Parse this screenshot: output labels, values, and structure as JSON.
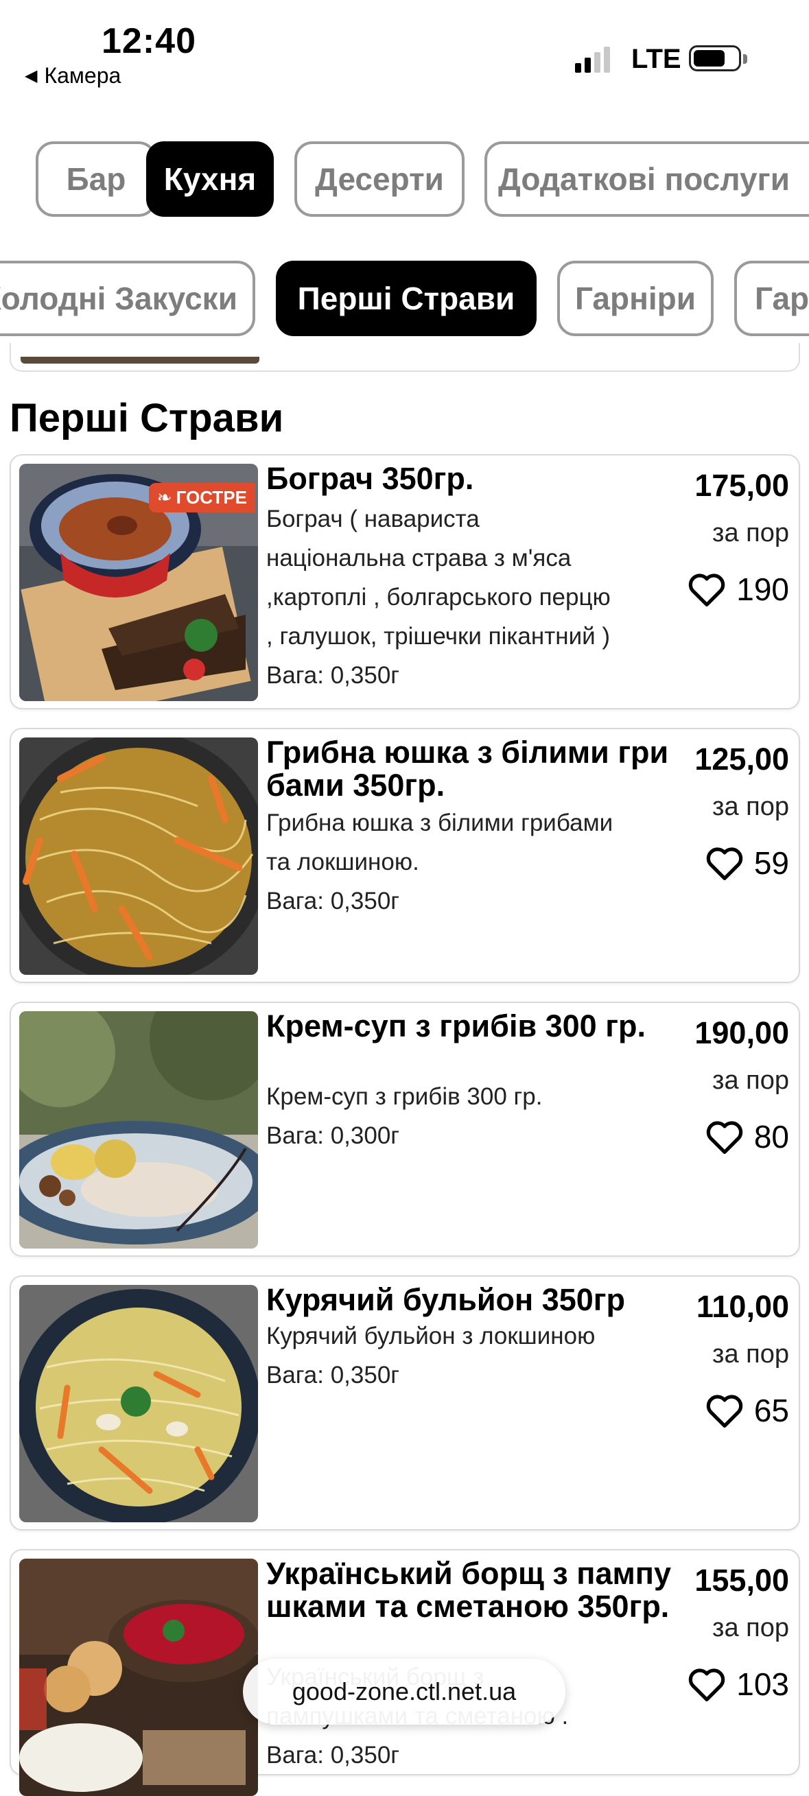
{
  "status_bar": {
    "time": "12:40",
    "back_label": "Камера",
    "network": "LTE",
    "signal_bars": 2
  },
  "category_tabs": [
    {
      "label": "Бар",
      "active": false
    },
    {
      "label": "Кухня",
      "active": true
    },
    {
      "label": "Десерти",
      "active": false
    },
    {
      "label": "Додаткові послуги",
      "active": false
    }
  ],
  "subcategory_tabs": [
    {
      "label": "Холодні Закуски",
      "active": false
    },
    {
      "label": "Перші Страви",
      "active": true
    },
    {
      "label": "Гарніри",
      "active": false
    },
    {
      "label": "Гар",
      "active": false
    }
  ],
  "section": {
    "title": "Перші Страви"
  },
  "unit_label": "за пор",
  "dishes": [
    {
      "title": "Бограч 350гр.",
      "description_lines": [
        "Бограч ( нава­риста",
        "національна страва з м'яса",
        ",картоплі , болгарського перцю",
        ", галушок, трішечки пікантний )"
      ],
      "weight": "Вага: 0,350г",
      "price": "175,00",
      "likes": "190",
      "badge": "ГОСТРЕ"
    },
    {
      "title": "Грибна юшка з білими грибами 350гр.",
      "description_lines": [
        "Грибна юшка з білими грибами",
        "та локшиною."
      ],
      "weight": "Вага: 0,350г",
      "price": "125,00",
      "likes": "59"
    },
    {
      "title": "Крем-суп з грибів 300 гр.",
      "description_lines": [
        "Крем-суп з грибів 300 гр."
      ],
      "weight": "Вага: 0,300г",
      "price": "190,00",
      "likes": "80"
    },
    {
      "title": "Курячий бульйон 350гр",
      "description_lines": [
        "Курячий бульйон з локшиною"
      ],
      "weight": "Вага: 0,350г",
      "price": "110,00",
      "likes": "65"
    },
    {
      "title": "Український борщ з пампушками та сметаною 350гр.",
      "description_lines": [
        "Український борщ з",
        "пампушками та сметаною ."
      ],
      "weight": "Вага: 0,350г",
      "price": "155,00",
      "likes": "103"
    }
  ],
  "browser": {
    "url": "good-zone.ctl.net.ua"
  },
  "colors": {
    "accent": "#000000",
    "chip_border": "#9a9a9a",
    "badge": "#e04b2e"
  }
}
